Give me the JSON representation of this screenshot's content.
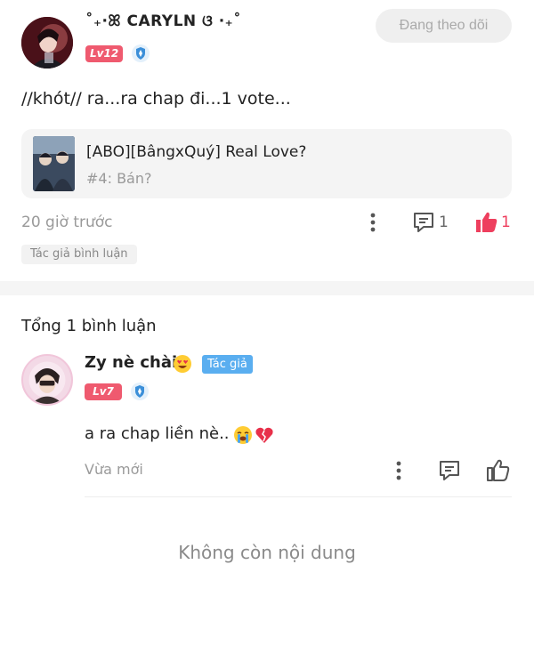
{
  "post": {
    "username": "˚₊·ꕤ CARYLN ଓ ·₊˚",
    "level": "Lv12",
    "follow_label": "Đang theo dõi",
    "text": "//khót// ra...ra chap đi...1 vote...",
    "book": {
      "title": "[ABO][BângxQuý] Real Love?",
      "chapter": "#4: Bán?"
    },
    "time": "20 giờ trước",
    "comment_count": "1",
    "like_count": "1",
    "tag": "Tác giả bình luận"
  },
  "comments_header": "Tổng 1 bình luận",
  "comment": {
    "name": "Zy nè chài",
    "author_tag": "Tác giả",
    "level": "Lv7",
    "text": "a ra chap liền nè..",
    "time": "Vừa mới"
  },
  "end_text": "Không còn nội dung",
  "colors": {
    "like_red": "#ee3f5e",
    "level_badge": "#ef5a6f",
    "author_tag": "#5aaef0",
    "follow_bg": "#efefef"
  }
}
